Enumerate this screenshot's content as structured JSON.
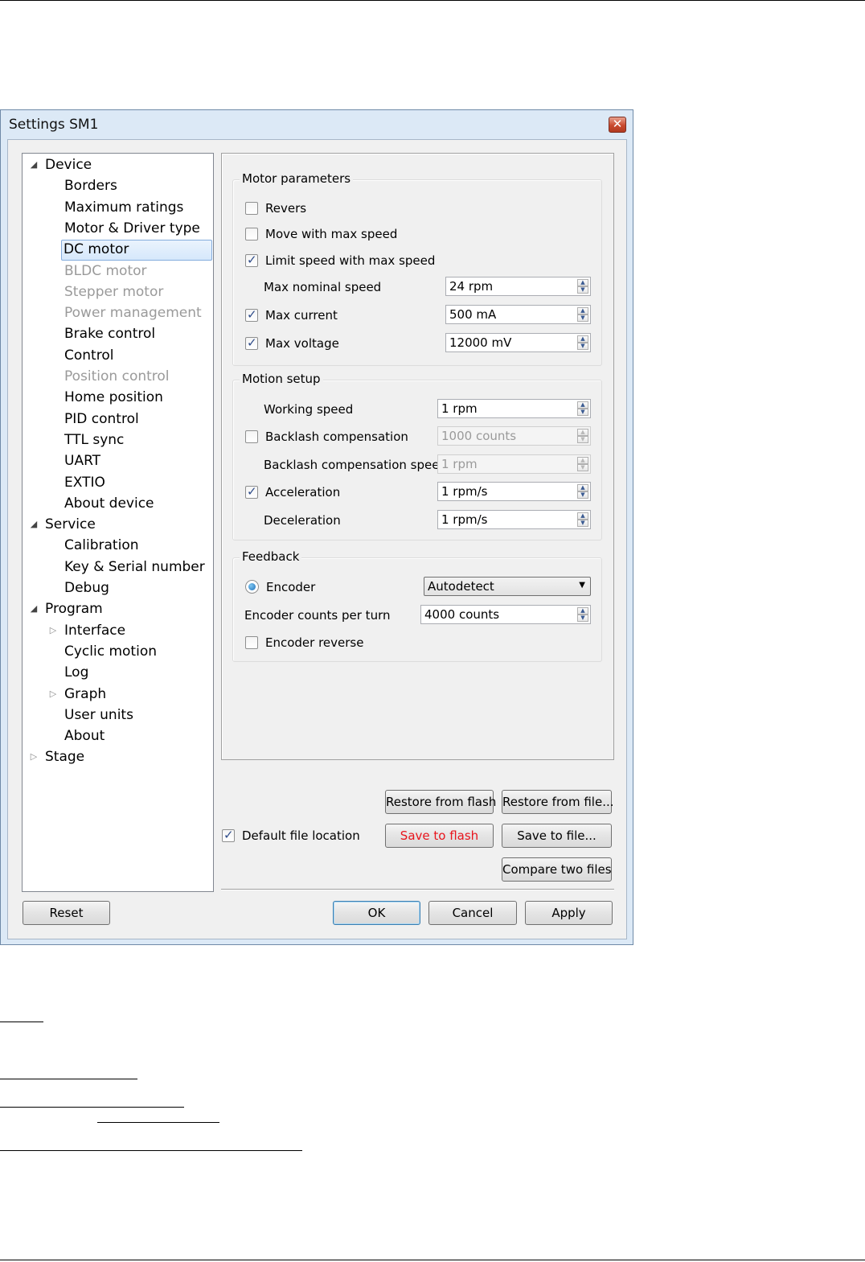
{
  "window": {
    "title": "Settings SM1",
    "close_glyph": "✕"
  },
  "tree": {
    "items": [
      {
        "label": "Device",
        "arrow": "open"
      },
      {
        "label": "Borders"
      },
      {
        "label": "Maximum ratings"
      },
      {
        "label": "Motor & Driver type"
      },
      {
        "label": "DC motor",
        "selected": true
      },
      {
        "label": "BLDC motor",
        "disabled": true
      },
      {
        "label": "Stepper motor",
        "disabled": true
      },
      {
        "label": "Power management",
        "disabled": true
      },
      {
        "label": "Brake control"
      },
      {
        "label": "Control"
      },
      {
        "label": "Position control",
        "disabled": true
      },
      {
        "label": "Home position"
      },
      {
        "label": "PID control"
      },
      {
        "label": "TTL sync"
      },
      {
        "label": "UART"
      },
      {
        "label": "EXTIO"
      },
      {
        "label": "About device"
      },
      {
        "label": "Service",
        "arrow": "open"
      },
      {
        "label": "Calibration"
      },
      {
        "label": "Key & Serial number"
      },
      {
        "label": "Debug"
      },
      {
        "label": "Program",
        "arrow": "open"
      },
      {
        "label": "Interface",
        "arrow": "closed"
      },
      {
        "label": "Cyclic motion"
      },
      {
        "label": "Log"
      },
      {
        "label": "Graph",
        "arrow": "closed"
      },
      {
        "label": "User units"
      },
      {
        "label": "About"
      },
      {
        "label": "Stage",
        "arrow": "closed"
      }
    ]
  },
  "motor": {
    "title": "Motor parameters",
    "revers": {
      "label": "Revers",
      "checked": false
    },
    "move_max": {
      "label": "Move with max speed",
      "checked": false
    },
    "limit_speed": {
      "label": "Limit speed with max speed",
      "checked": true
    },
    "max_nominal": {
      "label": "Max nominal speed",
      "value": "24 rpm"
    },
    "max_current": {
      "label": "Max current",
      "checked": true,
      "value": "500 mA"
    },
    "max_voltage": {
      "label": "Max voltage",
      "checked": true,
      "value": "12000 mV"
    }
  },
  "motion": {
    "title": "Motion setup",
    "working_speed": {
      "label": "Working speed",
      "value": "1 rpm"
    },
    "backlash": {
      "label": "Backlash compensation",
      "checked": false,
      "value": "1000 counts"
    },
    "backlash_speed": {
      "label": "Backlash compensation speed",
      "value": "1 rpm"
    },
    "acceleration": {
      "label": "Acceleration",
      "checked": true,
      "value": "1 rpm/s"
    },
    "deceleration": {
      "label": "Deceleration",
      "value": "1 rpm/s"
    }
  },
  "feedback": {
    "title": "Feedback",
    "encoder": {
      "label": "Encoder",
      "selected": true
    },
    "encoder_type": "Autodetect",
    "counts": {
      "label": "Encoder counts per turn",
      "value": "4000 counts"
    },
    "reverse": {
      "label": "Encoder reverse",
      "checked": false
    }
  },
  "actions": {
    "restore_flash": "Restore from flash",
    "restore_file": "Restore from file...",
    "default_location": {
      "label": "Default file location",
      "checked": true
    },
    "save_flash": "Save to flash",
    "save_file": "Save to file...",
    "compare": "Compare two files",
    "reset": "Reset",
    "ok": "OK",
    "cancel": "Cancel",
    "apply": "Apply"
  },
  "glyphs": {
    "check": "✓",
    "up": "▲",
    "down": "▼",
    "tree_open": "◢",
    "tree_closed": "▷",
    "dropdown": "▼"
  },
  "colors": {
    "save_to_flash_text": "#e8141c",
    "selection": "#d6e8fb"
  }
}
